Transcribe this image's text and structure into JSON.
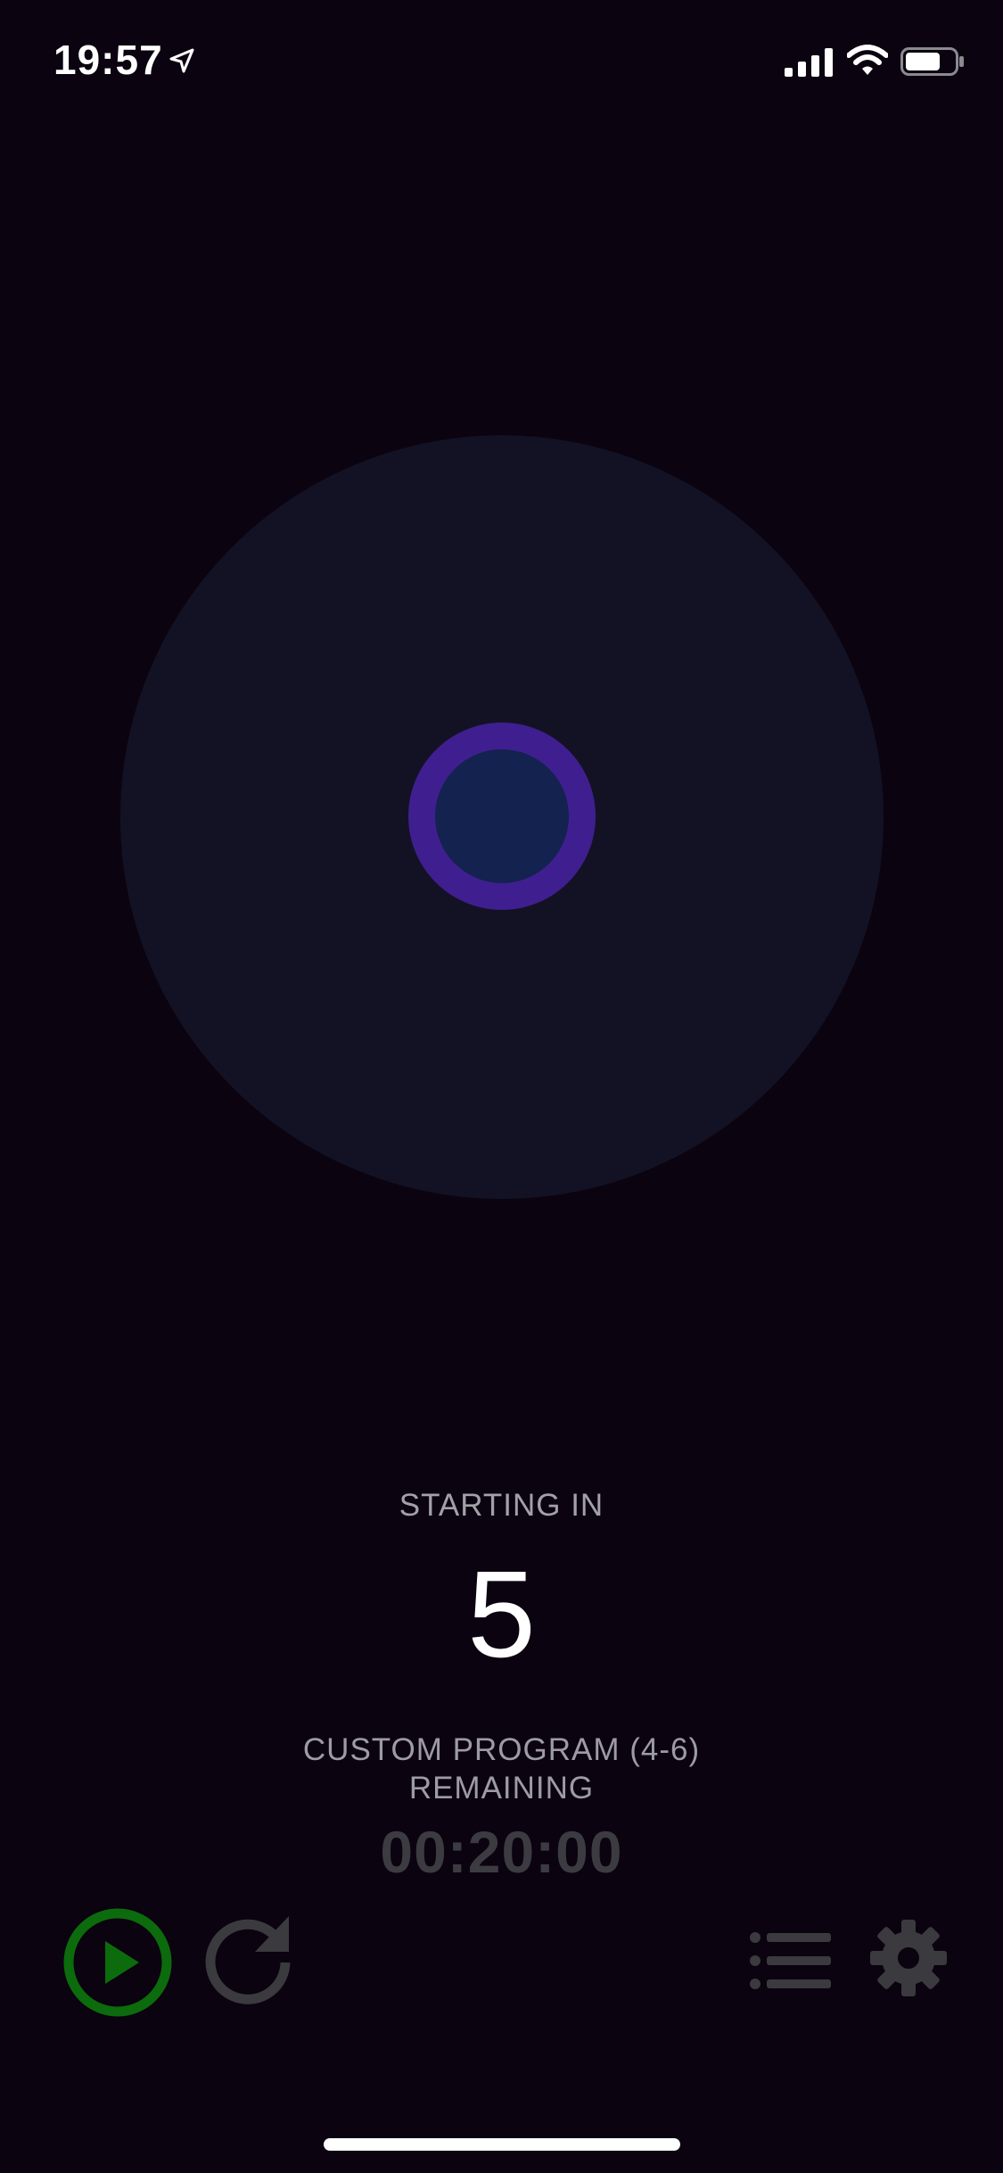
{
  "status_bar": {
    "time": "19:57",
    "icons": [
      "location-arrow-icon",
      "signal-icon",
      "wifi-icon",
      "battery-icon"
    ],
    "battery_level": 0.65
  },
  "breathing": {
    "outer_color": "#131225",
    "ring_color": "#3f1f8f",
    "inner_color": "#13224f"
  },
  "countdown": {
    "label": "STARTING IN",
    "value": "5"
  },
  "program": {
    "name": "CUSTOM PROGRAM (4-6)",
    "remaining_label": "REMAINING",
    "remaining_time": "00:20:00"
  },
  "controls": {
    "play": {
      "icon": "play-icon",
      "color": "#0c6b0c"
    },
    "reset": {
      "icon": "reset-icon",
      "color": "#3a3a3f"
    },
    "list": {
      "icon": "list-icon",
      "color": "#3a3a3f"
    },
    "settings": {
      "icon": "gear-icon",
      "color": "#3a3a3f"
    }
  }
}
